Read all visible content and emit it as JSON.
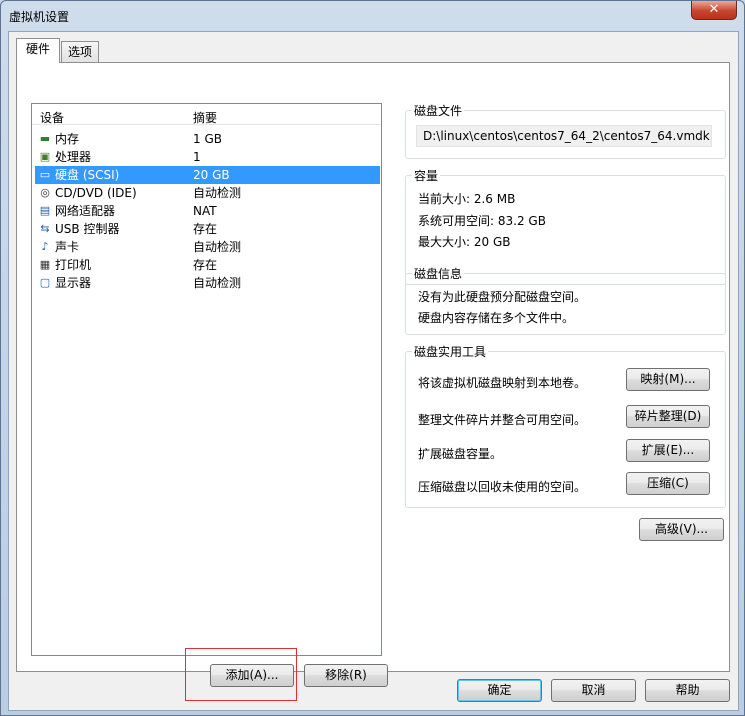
{
  "window": {
    "title": "虚拟机设置",
    "close_glyph": "✕"
  },
  "tabs": [
    {
      "label": "硬件"
    },
    {
      "label": "选项"
    }
  ],
  "devices": {
    "header": {
      "device": "设备",
      "summary": "摘要"
    },
    "items": [
      {
        "name": "内存",
        "summary": "1 GB",
        "icon": "memory-icon",
        "glyph": "▬"
      },
      {
        "name": "处理器",
        "summary": "1",
        "icon": "processor-icon",
        "glyph": "▣"
      },
      {
        "name": "硬盘 (SCSI)",
        "summary": "20 GB",
        "icon": "hard-disk-icon",
        "glyph": "▭",
        "selected": true
      },
      {
        "name": "CD/DVD (IDE)",
        "summary": "自动检测",
        "icon": "cd-dvd-icon",
        "glyph": "◎"
      },
      {
        "name": "网络适配器",
        "summary": "NAT",
        "icon": "network-adapter-icon",
        "glyph": "▤"
      },
      {
        "name": "USB 控制器",
        "summary": "存在",
        "icon": "usb-icon",
        "glyph": "⇆"
      },
      {
        "name": "声卡",
        "summary": "自动检测",
        "icon": "sound-card-icon",
        "glyph": "♪"
      },
      {
        "name": "打印机",
        "summary": "存在",
        "icon": "printer-icon",
        "glyph": "▦"
      },
      {
        "name": "显示器",
        "summary": "自动检测",
        "icon": "display-icon",
        "glyph": "▢"
      }
    ],
    "add_label": "添加(A)...",
    "remove_label": "移除(R)"
  },
  "disk_file": {
    "title": "磁盘文件",
    "path": "D:\\linux\\centos\\centos7_64_2\\centos7_64.vmdk"
  },
  "capacity": {
    "title": "容量",
    "current_size": "当前大小: 2.6 MB",
    "available": "系统可用空间: 83.2 GB",
    "max_size": "最大大小: 20 GB"
  },
  "disk_info": {
    "title": "磁盘信息",
    "line1": "没有为此硬盘预分配磁盘空间。",
    "line2": "硬盘内容存储在多个文件中。"
  },
  "utilities": {
    "title": "磁盘实用工具",
    "map_text": "将该虚拟机磁盘映射到本地卷。",
    "map_label": "映射(M)...",
    "defrag_text": "整理文件碎片并整合可用空间。",
    "defrag_label": "碎片整理(D)",
    "expand_text": "扩展磁盘容量。",
    "expand_label": "扩展(E)...",
    "compact_text": "压缩磁盘以回收未使用的空间。",
    "compact_label": "压缩(C)"
  },
  "advanced_label": "高级(V)...",
  "footer": {
    "ok": "确定",
    "cancel": "取消",
    "help": "帮助"
  }
}
